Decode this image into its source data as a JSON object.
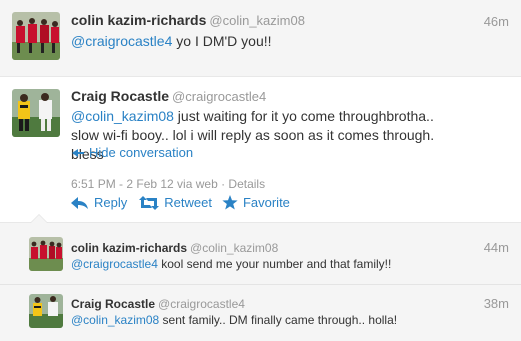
{
  "tweet1": {
    "fullname": "colin kazim-richards",
    "username": "@colin_kazim08",
    "time": "46m",
    "mention": "@craigrocastle4",
    "text": " yo I DM'D you!!"
  },
  "tweet2": {
    "fullname": "Craig Rocastle",
    "username": "@craigrocastle4",
    "mention": "@colin_kazim08",
    "text": " just waiting for it yo come throughbrotha.. slow wi-fi booy.. lol i will reply as soon as it comes through. bless",
    "hide_conversation": "Hide conversation",
    "timestamp": "6:51 PM - 2 Feb 12 via web",
    "separator": " · ",
    "details": "Details",
    "actions": {
      "reply": "Reply",
      "retweet": "Retweet",
      "favorite": "Favorite"
    }
  },
  "replies": [
    {
      "fullname": "colin kazim-richards",
      "username": "@colin_kazim08",
      "time": "44m",
      "mention": "@craigrocastle4",
      "text": " kool send me your number and that family!!"
    },
    {
      "fullname": "Craig Rocastle",
      "username": "@craigrocastle4",
      "time": "38m",
      "mention": "@colin_kazim08",
      "text": " sent family.. DM finally came through.. holla!"
    }
  ],
  "colors": {
    "link": "#2a82c5",
    "muted": "#999999",
    "background": "#f5f5f5"
  },
  "icons": [
    "reply-arrow-icon",
    "retweet-icon",
    "favorite-star-icon",
    "expand-arrow-icon"
  ]
}
